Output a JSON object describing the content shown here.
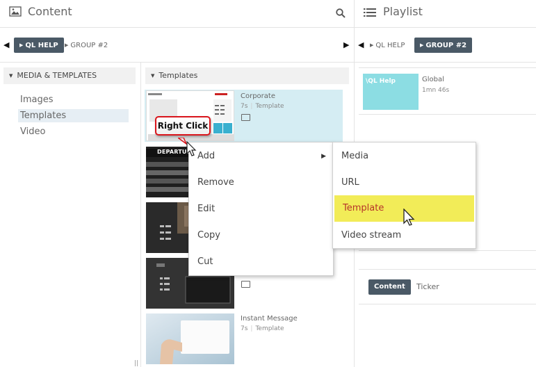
{
  "content_panel": {
    "title": "Content",
    "groups": [
      {
        "label": "QL HELP",
        "active": true
      },
      {
        "label": "GROUP #2",
        "active": false
      }
    ],
    "sidebar": {
      "section_label": "MEDIA & TEMPLATES",
      "items": [
        {
          "label": "Images",
          "selected": false
        },
        {
          "label": "Templates",
          "selected": true
        },
        {
          "label": "Video",
          "selected": false
        }
      ]
    },
    "templates": {
      "section_label": "Templates",
      "items": [
        {
          "title": "Corporate",
          "duration": "7s",
          "type": "Template"
        },
        {
          "title": "Instant Message",
          "duration": "7s",
          "type": "Template"
        }
      ],
      "thumb_caption": "DEPARTURES"
    }
  },
  "playlist_panel": {
    "title": "Playlist",
    "groups": [
      {
        "label": "QL HELP",
        "active": false
      },
      {
        "label": "GROUP #2",
        "active": true
      }
    ],
    "item": {
      "thumb_label": "\\QL Help",
      "title": "Global",
      "duration": "1mn 46s"
    },
    "tabs": [
      {
        "label": "Content",
        "active": true
      },
      {
        "label": "Ticker",
        "active": false
      }
    ]
  },
  "context_menu": {
    "items": [
      "Add",
      "Remove",
      "Edit",
      "Copy",
      "Cut"
    ]
  },
  "submenu": {
    "items": [
      "Media",
      "URL",
      "Template",
      "Video stream"
    ],
    "highlighted": "Template"
  },
  "callout": {
    "label": "Right Click"
  },
  "colors": {
    "active_tab": "#4a5966",
    "selected_row": "#d5edf3",
    "playlist_thumb": "#8cdde3",
    "highlight": "#f2ec58",
    "highlight_text": "#b6332a",
    "callout_border": "#d9141b"
  }
}
